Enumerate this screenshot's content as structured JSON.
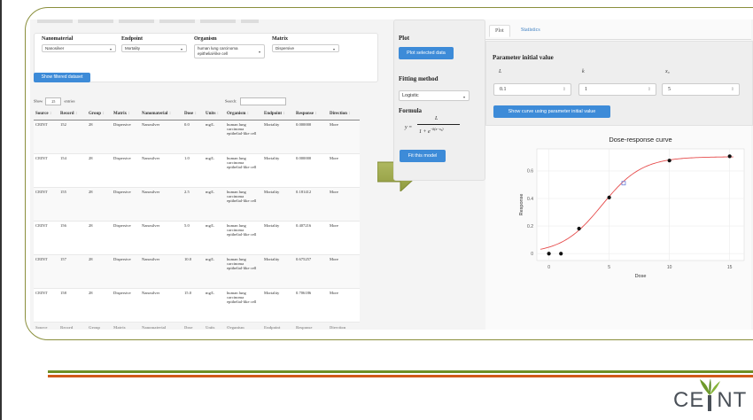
{
  "filters": {
    "nanomaterial": {
      "label": "Nanomaterial",
      "value": "Nanosilver"
    },
    "endpoint": {
      "label": "Endpoint",
      "value": "Mortality"
    },
    "organism": {
      "label": "Organism",
      "value_line1": "human lung carcinoma",
      "value_line2": "epithelial-like cell"
    },
    "matrix": {
      "label": "Matrix",
      "value": "Dispersive"
    }
  },
  "show_filtered_label": "Show filtered dataset",
  "table_controls": {
    "show_label": "Show",
    "show_value": "25",
    "entries_label": "entries",
    "search_label": "Search:"
  },
  "table": {
    "columns": [
      "Source",
      "Record",
      "Group",
      "Matrix",
      "Nanomaterial",
      "Dose",
      "Units",
      "Organism",
      "Endpoint",
      "Response",
      "Direction"
    ],
    "rows": [
      [
        "CEINT",
        "152",
        "28",
        "Dispersive",
        "Nanosilver",
        "0.0",
        "mg/L",
        "human lung carcinoma epithelial-like cell",
        "Mortality",
        "0.000000",
        "More"
      ],
      [
        "CEINT",
        "154",
        "28",
        "Dispersive",
        "Nanosilver",
        "1.0",
        "mg/L",
        "human lung carcinoma epithelial-like cell",
        "Mortality",
        "0.000000",
        "More"
      ],
      [
        "CEINT",
        "155",
        "28",
        "Dispersive",
        "Nanosilver",
        "2.5",
        "mg/L",
        "human lung carcinoma epithelial-like cell",
        "Mortality",
        "0.181412",
        "More"
      ],
      [
        "CEINT",
        "156",
        "28",
        "Dispersive",
        "Nanosilver",
        "5.0",
        "mg/L",
        "human lung carcinoma epithelial-like cell",
        "Mortality",
        "0.407216",
        "More"
      ],
      [
        "CEINT",
        "157",
        "28",
        "Dispersive",
        "Nanosilver",
        "10.0",
        "mg/L",
        "human lung carcinoma epithelial-like cell",
        "Mortality",
        "0.675257",
        "More"
      ],
      [
        "CEINT",
        "158",
        "28",
        "Dispersive",
        "Nanosilver",
        "15.0",
        "mg/L",
        "human lung carcinoma epithelial-like cell",
        "Mortality",
        "0.706186",
        "More"
      ]
    ]
  },
  "side": {
    "plot_heading": "Plot",
    "plot_selected_label": "Plot selected data",
    "fitting_heading": "Fitting method",
    "fitting_value": "Logistic",
    "formula_heading": "Formula",
    "formula_lhs": "y =",
    "formula_num": "L",
    "formula_den": "1 + e",
    "formula_exp": "−k(x−x₀)",
    "fit_label": "Fit this model"
  },
  "tabs": {
    "plot": "Plot",
    "statistics": "Statistics"
  },
  "params": {
    "title": "Parameter initial value",
    "L_label": "L",
    "k_label": "k",
    "x0_label": "x₀",
    "L_value": "0.1",
    "k_value": "1",
    "x0_value": "5",
    "show_curve_label": "Show curve using parameter initial value"
  },
  "chart_data": {
    "type": "scatter",
    "title": "Dose-response curve",
    "xlabel": "Dose",
    "ylabel": "Response",
    "xlim": [
      -1.0,
      16.2
    ],
    "ylim": [
      -0.05,
      0.76
    ],
    "xticks": [
      0,
      5,
      10,
      15
    ],
    "yticks": [
      0.0,
      0.2,
      0.4,
      0.6
    ],
    "x": [
      0,
      1,
      2.5,
      5,
      10,
      15
    ],
    "y": [
      0.0,
      0.0,
      0.181412,
      0.407216,
      0.675257,
      0.706186
    ],
    "fit": {
      "L": 0.703,
      "k": 0.6,
      "x0": 4.4
    },
    "highlight": {
      "x": 6.2,
      "y": 0.511
    },
    "grid": true,
    "curve_color": "#e64b4b",
    "point_color": "#111111",
    "highlight_color": "#6b7fd9"
  },
  "logo": {
    "text_left": "CE",
    "text_right": "NT"
  },
  "colors": {
    "accent_blue": "#3d8bd8",
    "rule_green": "#6e8f26",
    "rule_orange": "#d1591a",
    "frame": "#8a8f3c"
  }
}
